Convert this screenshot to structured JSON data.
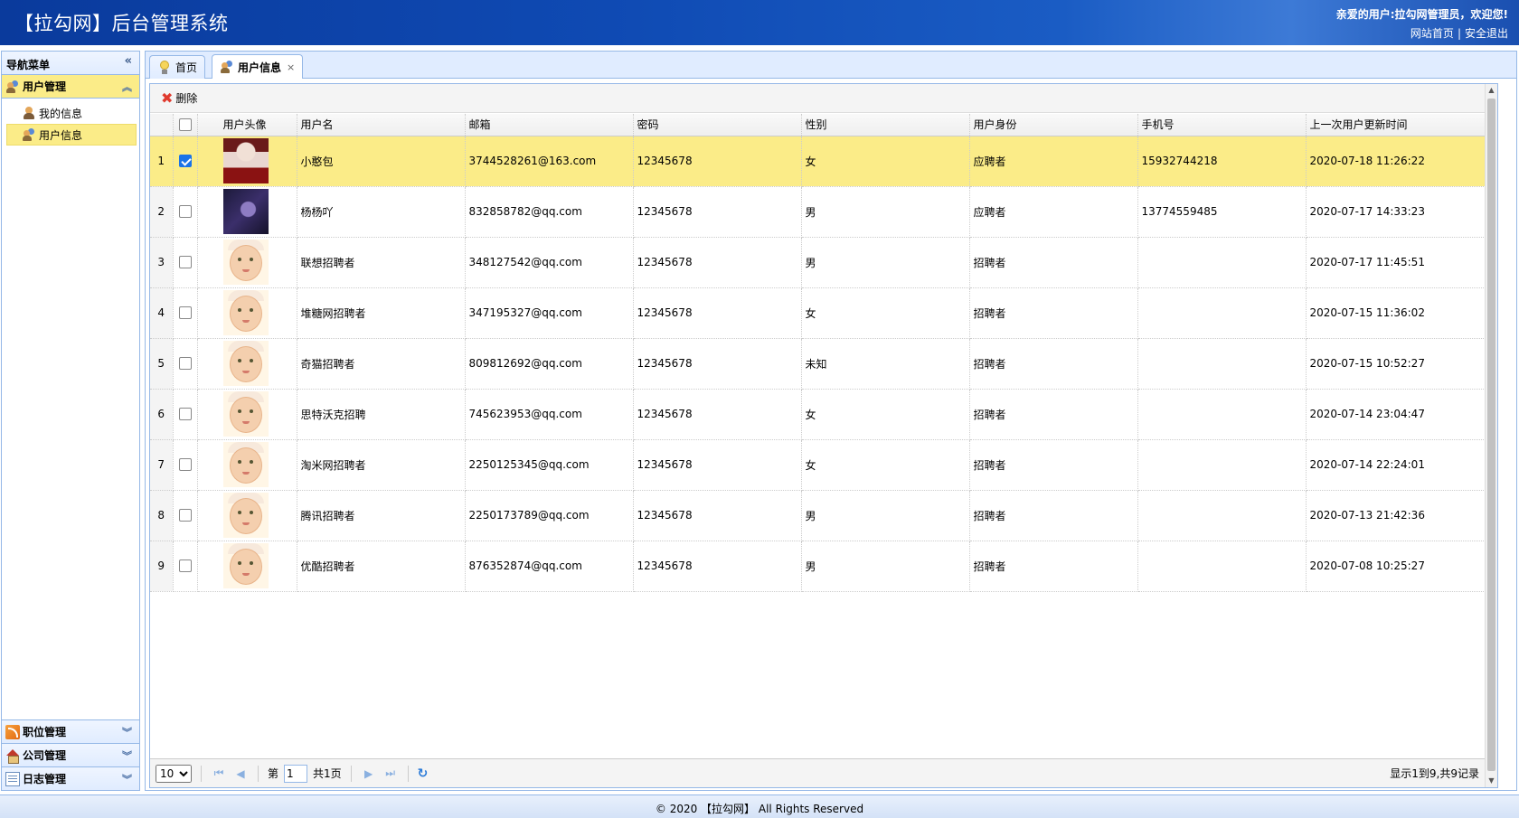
{
  "header": {
    "title": "【拉勾网】后台管理系统",
    "welcome": "亲爱的用户:拉勾网管理员，欢迎您!",
    "link_home": "网站首页",
    "link_sep": "|",
    "link_logout": "安全退出"
  },
  "sidebar": {
    "nav_title": "导航菜单",
    "collapse_glyph": "«",
    "sections": [
      {
        "label": "用户管理",
        "chevron": "︽",
        "items": [
          "我的信息",
          "用户信息"
        ]
      },
      {
        "label": "职位管理",
        "chevron": "︾"
      },
      {
        "label": "公司管理",
        "chevron": "︾"
      },
      {
        "label": "日志管理",
        "chevron": "︾"
      }
    ]
  },
  "tabs": [
    {
      "label": "首页"
    },
    {
      "label": "用户信息",
      "close": "×"
    }
  ],
  "toolbar": {
    "delete_label": "删除",
    "delete_glyph": "✖"
  },
  "table": {
    "columns": [
      "用户头像",
      "用户名",
      "邮箱",
      "密码",
      "性别",
      "用户身份",
      "手机号",
      "上一次用户更新时间"
    ],
    "rows": [
      {
        "num": "1",
        "checked": true,
        "avatar": "a1",
        "username": "小憨包",
        "email": "3744528261@163.com",
        "password": "12345678",
        "gender": "女",
        "role": "应聘者",
        "phone": "15932744218",
        "updated": "2020-07-18 11:26:22"
      },
      {
        "num": "2",
        "checked": false,
        "avatar": "a2",
        "username": "杨杨吖",
        "email": "832858782@qq.com",
        "password": "12345678",
        "gender": "男",
        "role": "应聘者",
        "phone": "13774559485",
        "updated": "2020-07-17 14:33:23"
      },
      {
        "num": "3",
        "checked": false,
        "avatar": "baby",
        "username": "联想招聘者",
        "email": "348127542@qq.com",
        "password": "12345678",
        "gender": "男",
        "role": "招聘者",
        "phone": "",
        "updated": "2020-07-17 11:45:51"
      },
      {
        "num": "4",
        "checked": false,
        "avatar": "baby",
        "username": "堆糖网招聘者",
        "email": "347195327@qq.com",
        "password": "12345678",
        "gender": "女",
        "role": "招聘者",
        "phone": "",
        "updated": "2020-07-15 11:36:02"
      },
      {
        "num": "5",
        "checked": false,
        "avatar": "baby",
        "username": "奇猫招聘者",
        "email": "809812692@qq.com",
        "password": "12345678",
        "gender": "未知",
        "role": "招聘者",
        "phone": "",
        "updated": "2020-07-15 10:52:27"
      },
      {
        "num": "6",
        "checked": false,
        "avatar": "baby",
        "username": "思特沃克招聘",
        "email": "745623953@qq.com",
        "password": "12345678",
        "gender": "女",
        "role": "招聘者",
        "phone": "",
        "updated": "2020-07-14 23:04:47"
      },
      {
        "num": "7",
        "checked": false,
        "avatar": "baby",
        "username": "淘米网招聘者",
        "email": "2250125345@qq.com",
        "password": "12345678",
        "gender": "女",
        "role": "招聘者",
        "phone": "",
        "updated": "2020-07-14 22:24:01"
      },
      {
        "num": "8",
        "checked": false,
        "avatar": "baby",
        "username": "腾讯招聘者",
        "email": "2250173789@qq.com",
        "password": "12345678",
        "gender": "男",
        "role": "招聘者",
        "phone": "",
        "updated": "2020-07-13 21:42:36"
      },
      {
        "num": "9",
        "checked": false,
        "avatar": "baby",
        "username": "优酷招聘者",
        "email": "876352874@qq.com",
        "password": "12345678",
        "gender": "男",
        "role": "招聘者",
        "phone": "",
        "updated": "2020-07-08 10:25:27"
      }
    ]
  },
  "pager": {
    "page_size": "10",
    "page_prefix": "第",
    "page_value": "1",
    "page_total": "共1页",
    "info": "显示1到9,共9记录",
    "first_glyph": "⏮",
    "prev_glyph": "◀",
    "next_glyph": "▶",
    "last_glyph": "⏭",
    "refresh_glyph": "↻"
  },
  "footer": {
    "text": "© 2020 【拉勾网】 All Rights Reserved"
  },
  "colors": {
    "header": "#0f4ab3",
    "selected": "#fbec88",
    "border": "#95b8e7"
  },
  "icons": {
    "tab_home": "bulb-icon",
    "tab_users": "users-icon",
    "delete": "delete-icon"
  }
}
